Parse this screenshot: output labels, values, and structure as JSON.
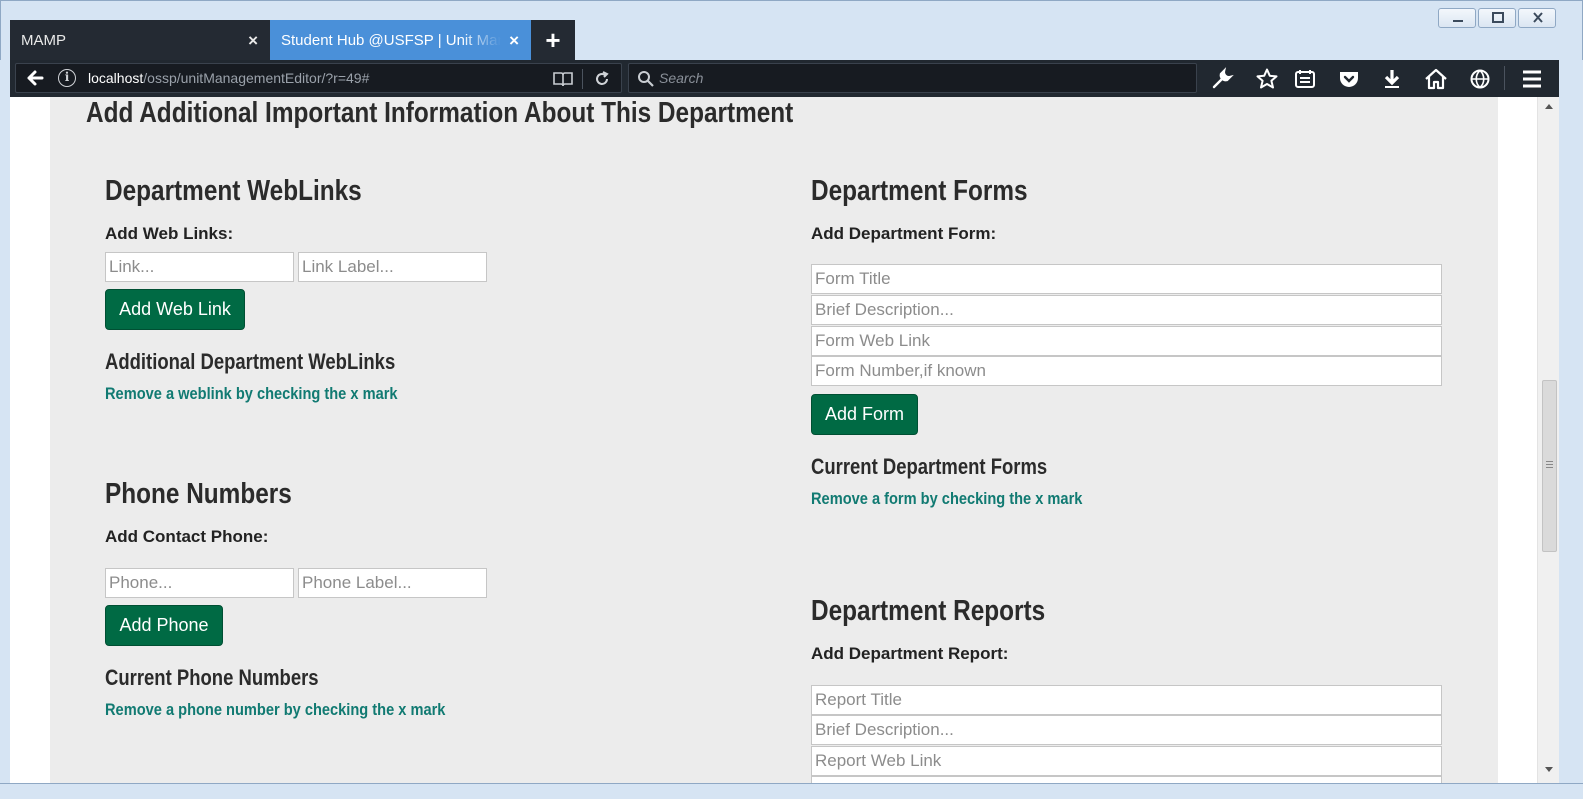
{
  "browser": {
    "tabs": [
      {
        "label": "MAMP",
        "close": "×"
      },
      {
        "label": "Student Hub @USFSP | Unit Management",
        "close": "×"
      }
    ],
    "new_tab": "+",
    "url": {
      "host": "localhost",
      "path": "/ossp/unitManagementEditor/?r=49#"
    },
    "search_placeholder": "Search",
    "toolbar_icons": [
      "wrench-icon",
      "star-icon",
      "reading-list-icon",
      "pocket-icon",
      "download-icon",
      "home-icon",
      "globe-icon",
      "menu-icon"
    ]
  },
  "page": {
    "heading": "Add Additional Important Information About This Department",
    "weblinks": {
      "title": "Department WebLinks",
      "label": "Add Web Links:",
      "link_placeholder": "Link...",
      "label_placeholder": "Link Label...",
      "button": "Add Web Link",
      "current_title": "Additional Department WebLinks",
      "help": "Remove a weblink by checking the x mark"
    },
    "phones": {
      "title": "Phone Numbers",
      "label": "Add Contact Phone:",
      "phone_placeholder": "Phone...",
      "label_placeholder": "Phone Label...",
      "button": "Add Phone",
      "current_title": "Current Phone Numbers",
      "help": "Remove a phone number by checking the x mark"
    },
    "forms": {
      "title": "Department Forms",
      "label": "Add Department Form:",
      "title_placeholder": "Form Title",
      "desc_placeholder": "Brief Description...",
      "link_placeholder": "Form Web Link",
      "number_placeholder": "Form Number,if known",
      "button": "Add Form",
      "current_title": "Current Department Forms",
      "help": "Remove a form by checking the x mark"
    },
    "reports": {
      "title": "Department Reports",
      "label": "Add Department Report:",
      "title_placeholder": "Report Title",
      "desc_placeholder": "Brief Description...",
      "link_placeholder": "Report Web Link"
    }
  },
  "colors": {
    "button_green": "#006a44",
    "help_teal": "#117a72",
    "panel_bg": "#ececec",
    "active_tab": "#4a90d9"
  }
}
